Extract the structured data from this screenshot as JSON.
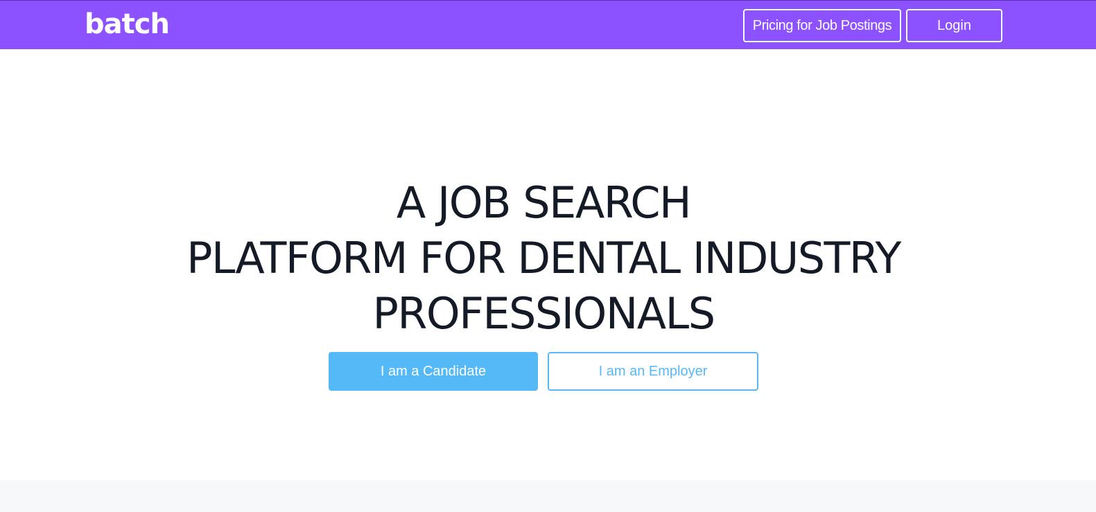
{
  "header": {
    "logo_text": "batch",
    "pricing_label": "Pricing for Job Postings",
    "login_label": "Login"
  },
  "hero": {
    "headline_lines": [
      "A JOB SEARCH",
      "PLATFORM FOR DENTAL INDUSTRY",
      "PROFESSIONALS"
    ],
    "candidate_label": "I am a Candidate",
    "employer_label": "I am an Employer"
  },
  "colors": {
    "header_bg": "#8c52ff",
    "accent_blue": "#56b9f7",
    "headline_text": "#141a26",
    "footer_band": "#f6f8fa"
  }
}
